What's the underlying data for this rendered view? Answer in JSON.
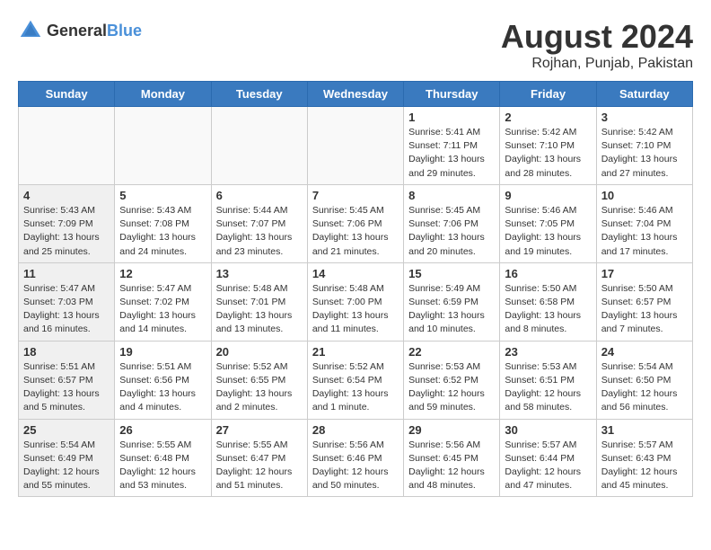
{
  "logo": {
    "text_general": "General",
    "text_blue": "Blue"
  },
  "title": {
    "month_year": "August 2024",
    "location": "Rojhan, Punjab, Pakistan"
  },
  "weekdays": [
    "Sunday",
    "Monday",
    "Tuesday",
    "Wednesday",
    "Thursday",
    "Friday",
    "Saturday"
  ],
  "weeks": [
    [
      {
        "day": "",
        "empty": true
      },
      {
        "day": "",
        "empty": true
      },
      {
        "day": "",
        "empty": true
      },
      {
        "day": "",
        "empty": true
      },
      {
        "day": "1",
        "info": "Sunrise: 5:41 AM\nSunset: 7:11 PM\nDaylight: 13 hours\nand 29 minutes."
      },
      {
        "day": "2",
        "info": "Sunrise: 5:42 AM\nSunset: 7:10 PM\nDaylight: 13 hours\nand 28 minutes."
      },
      {
        "day": "3",
        "info": "Sunrise: 5:42 AM\nSunset: 7:10 PM\nDaylight: 13 hours\nand 27 minutes."
      }
    ],
    [
      {
        "day": "4",
        "info": "Sunrise: 5:43 AM\nSunset: 7:09 PM\nDaylight: 13 hours\nand 25 minutes.",
        "shaded": true
      },
      {
        "day": "5",
        "info": "Sunrise: 5:43 AM\nSunset: 7:08 PM\nDaylight: 13 hours\nand 24 minutes."
      },
      {
        "day": "6",
        "info": "Sunrise: 5:44 AM\nSunset: 7:07 PM\nDaylight: 13 hours\nand 23 minutes."
      },
      {
        "day": "7",
        "info": "Sunrise: 5:45 AM\nSunset: 7:06 PM\nDaylight: 13 hours\nand 21 minutes."
      },
      {
        "day": "8",
        "info": "Sunrise: 5:45 AM\nSunset: 7:06 PM\nDaylight: 13 hours\nand 20 minutes."
      },
      {
        "day": "9",
        "info": "Sunrise: 5:46 AM\nSunset: 7:05 PM\nDaylight: 13 hours\nand 19 minutes."
      },
      {
        "day": "10",
        "info": "Sunrise: 5:46 AM\nSunset: 7:04 PM\nDaylight: 13 hours\nand 17 minutes."
      }
    ],
    [
      {
        "day": "11",
        "info": "Sunrise: 5:47 AM\nSunset: 7:03 PM\nDaylight: 13 hours\nand 16 minutes.",
        "shaded": true
      },
      {
        "day": "12",
        "info": "Sunrise: 5:47 AM\nSunset: 7:02 PM\nDaylight: 13 hours\nand 14 minutes."
      },
      {
        "day": "13",
        "info": "Sunrise: 5:48 AM\nSunset: 7:01 PM\nDaylight: 13 hours\nand 13 minutes."
      },
      {
        "day": "14",
        "info": "Sunrise: 5:48 AM\nSunset: 7:00 PM\nDaylight: 13 hours\nand 11 minutes."
      },
      {
        "day": "15",
        "info": "Sunrise: 5:49 AM\nSunset: 6:59 PM\nDaylight: 13 hours\nand 10 minutes."
      },
      {
        "day": "16",
        "info": "Sunrise: 5:50 AM\nSunset: 6:58 PM\nDaylight: 13 hours\nand 8 minutes."
      },
      {
        "day": "17",
        "info": "Sunrise: 5:50 AM\nSunset: 6:57 PM\nDaylight: 13 hours\nand 7 minutes."
      }
    ],
    [
      {
        "day": "18",
        "info": "Sunrise: 5:51 AM\nSunset: 6:57 PM\nDaylight: 13 hours\nand 5 minutes.",
        "shaded": true
      },
      {
        "day": "19",
        "info": "Sunrise: 5:51 AM\nSunset: 6:56 PM\nDaylight: 13 hours\nand 4 minutes."
      },
      {
        "day": "20",
        "info": "Sunrise: 5:52 AM\nSunset: 6:55 PM\nDaylight: 13 hours\nand 2 minutes."
      },
      {
        "day": "21",
        "info": "Sunrise: 5:52 AM\nSunset: 6:54 PM\nDaylight: 13 hours\nand 1 minute."
      },
      {
        "day": "22",
        "info": "Sunrise: 5:53 AM\nSunset: 6:52 PM\nDaylight: 12 hours\nand 59 minutes."
      },
      {
        "day": "23",
        "info": "Sunrise: 5:53 AM\nSunset: 6:51 PM\nDaylight: 12 hours\nand 58 minutes."
      },
      {
        "day": "24",
        "info": "Sunrise: 5:54 AM\nSunset: 6:50 PM\nDaylight: 12 hours\nand 56 minutes."
      }
    ],
    [
      {
        "day": "25",
        "info": "Sunrise: 5:54 AM\nSunset: 6:49 PM\nDaylight: 12 hours\nand 55 minutes.",
        "shaded": true
      },
      {
        "day": "26",
        "info": "Sunrise: 5:55 AM\nSunset: 6:48 PM\nDaylight: 12 hours\nand 53 minutes."
      },
      {
        "day": "27",
        "info": "Sunrise: 5:55 AM\nSunset: 6:47 PM\nDaylight: 12 hours\nand 51 minutes."
      },
      {
        "day": "28",
        "info": "Sunrise: 5:56 AM\nSunset: 6:46 PM\nDaylight: 12 hours\nand 50 minutes."
      },
      {
        "day": "29",
        "info": "Sunrise: 5:56 AM\nSunset: 6:45 PM\nDaylight: 12 hours\nand 48 minutes."
      },
      {
        "day": "30",
        "info": "Sunrise: 5:57 AM\nSunset: 6:44 PM\nDaylight: 12 hours\nand 47 minutes."
      },
      {
        "day": "31",
        "info": "Sunrise: 5:57 AM\nSunset: 6:43 PM\nDaylight: 12 hours\nand 45 minutes."
      }
    ]
  ]
}
